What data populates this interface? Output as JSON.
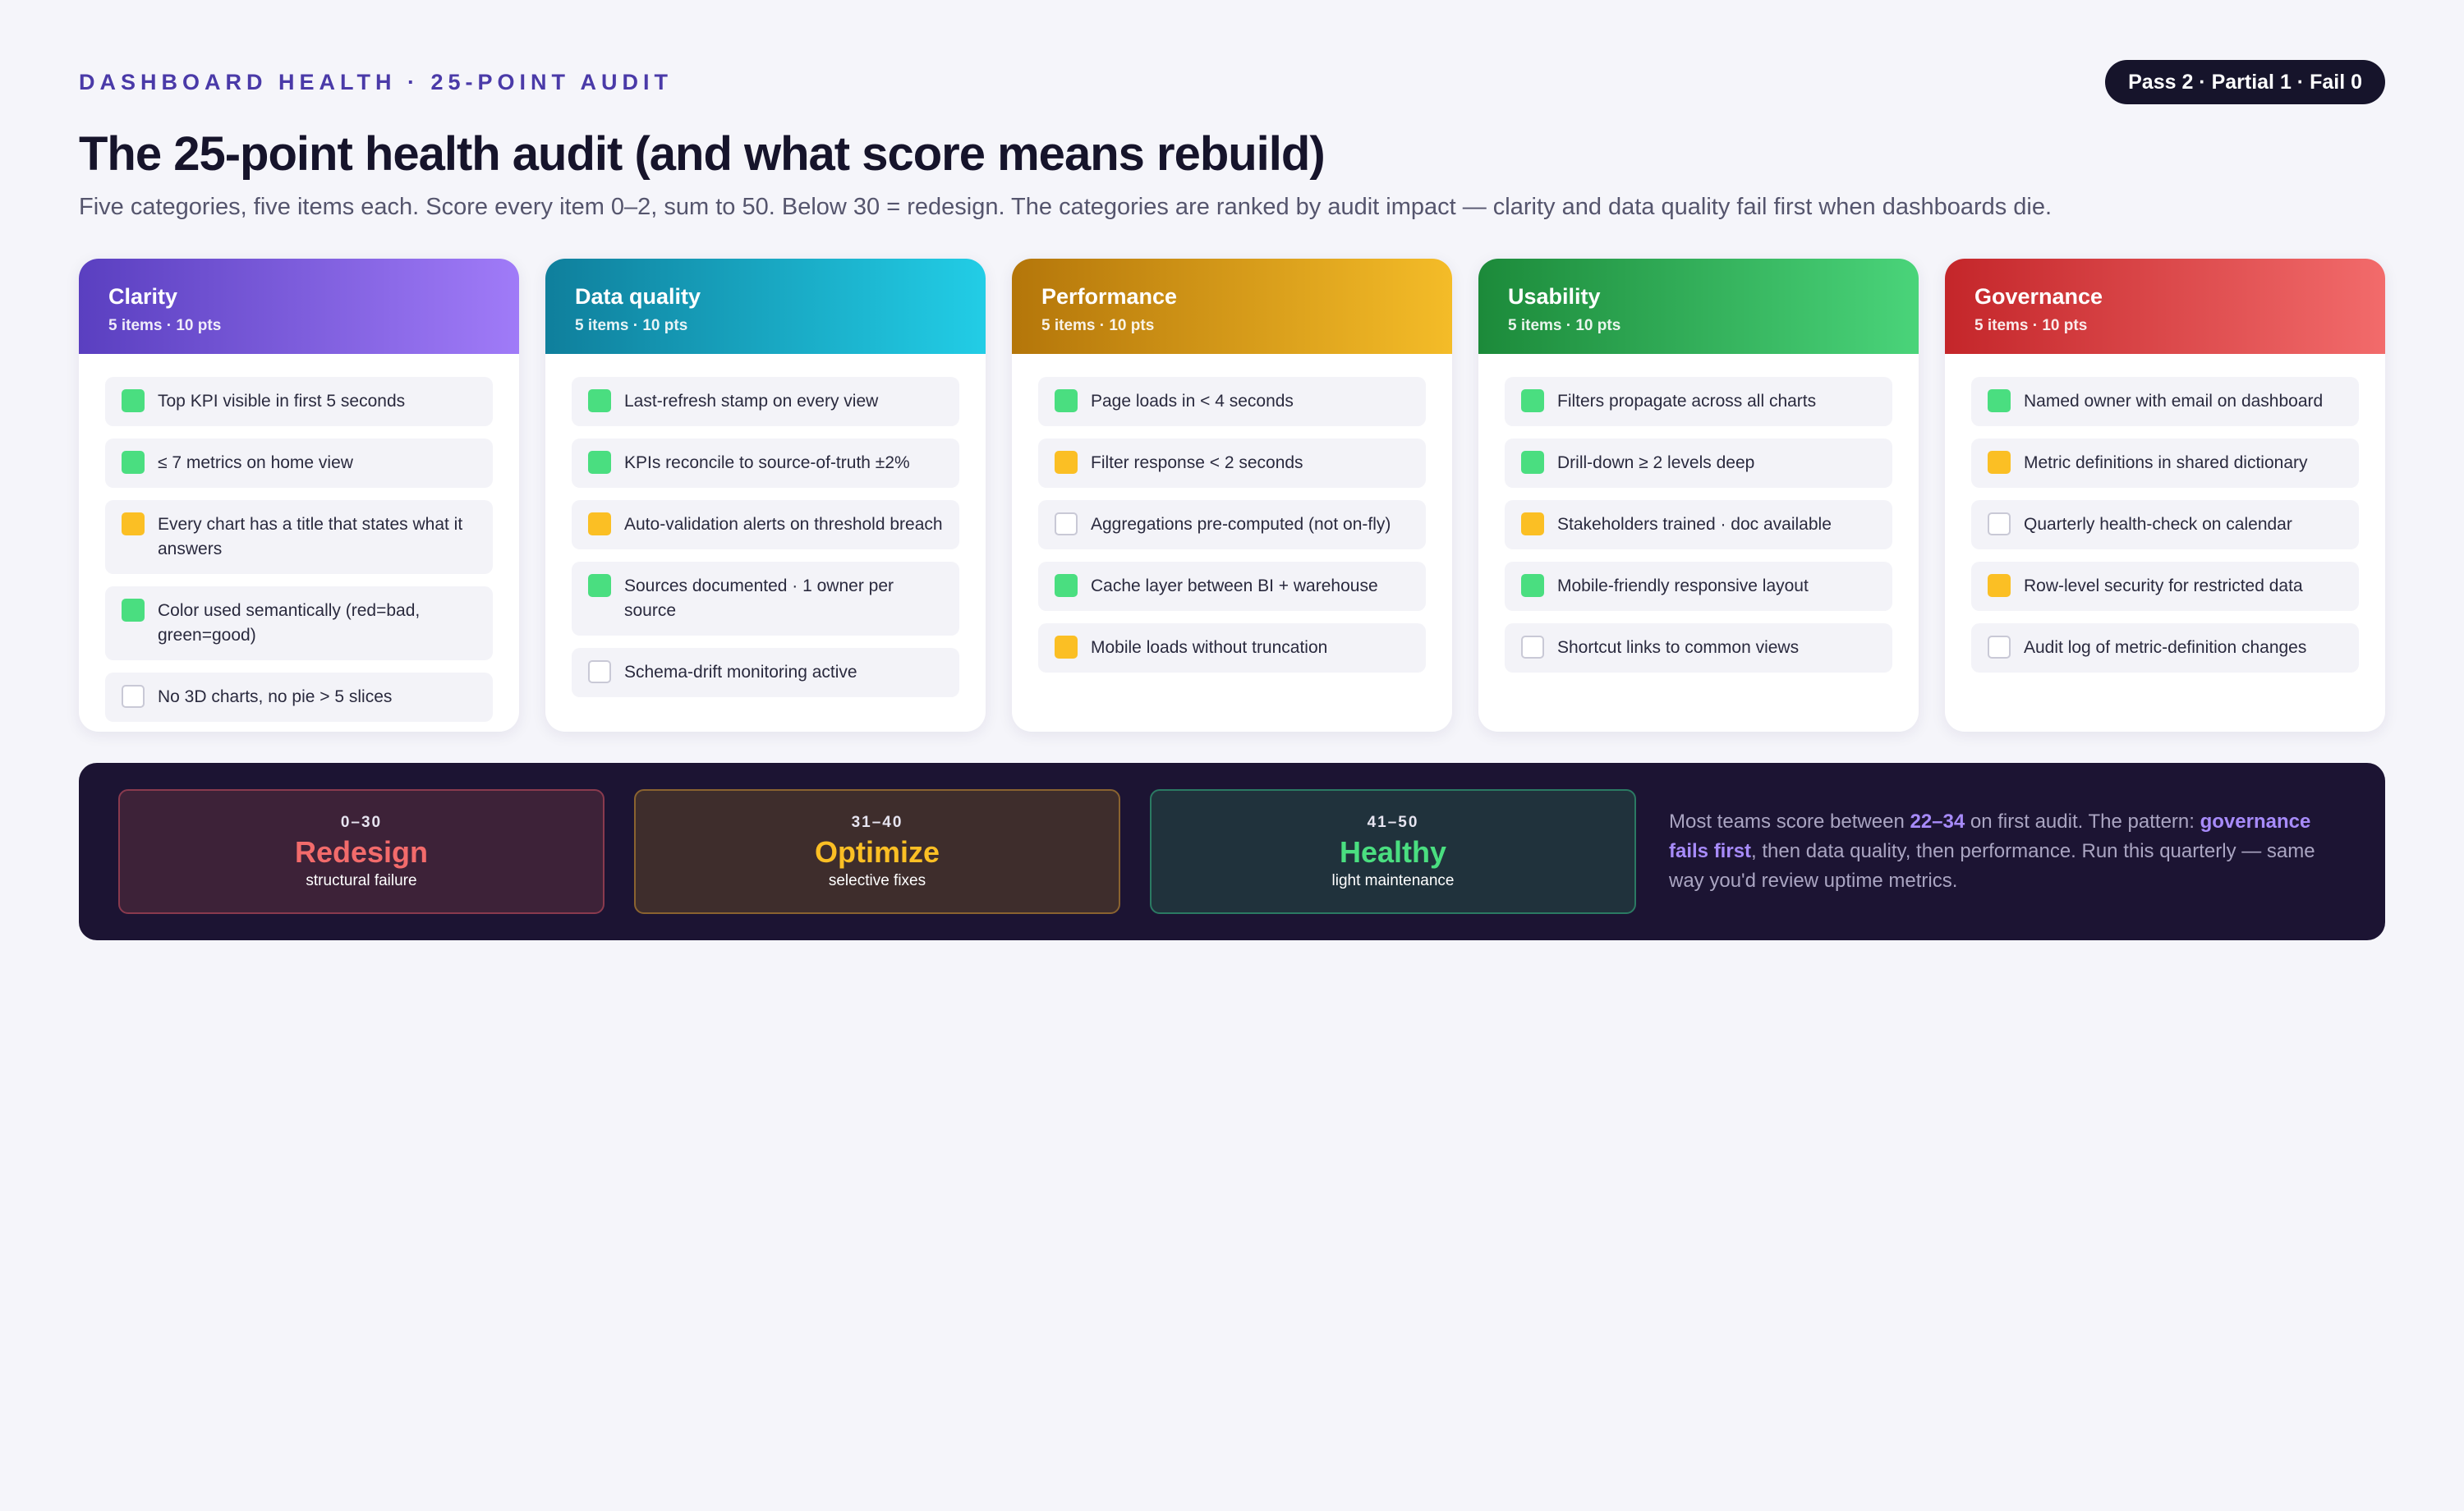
{
  "header": {
    "eyebrow": "DASHBOARD HEALTH · 25-POINT AUDIT",
    "score_summary": "Pass 2 · Partial 1 · Fail 0",
    "title": "The 25-point health audit (and what score means rebuild)",
    "subtitle": "Five categories, five items each. Score every item 0–2, sum to 50. Below 30 = redesign. The categories are ranked by audit impact — clarity and data quality fail first when dashboards die."
  },
  "status_colors": {
    "pass": "#4ade80",
    "partial": "#fbbf24",
    "fail": "#ffffff"
  },
  "categories": [
    {
      "name": "Clarity",
      "meta": "5 items · 10 pts",
      "color_from": "#5a3fc0",
      "color_to": "#a07bf8",
      "items": [
        {
          "text": "Top KPI visible in first 5 seconds",
          "status": "pass"
        },
        {
          "text": "≤ 7 metrics on home view",
          "status": "pass"
        },
        {
          "text": "Every chart has a title that states what it answers",
          "status": "partial"
        },
        {
          "text": "Color used semantically (red=bad, green=good)",
          "status": "pass"
        },
        {
          "text": "No 3D charts, no pie > 5 slices",
          "status": "fail"
        }
      ]
    },
    {
      "name": "Data quality",
      "meta": "5 items · 10 pts",
      "color_from": "#0f7f9c",
      "color_to": "#22cde6",
      "items": [
        {
          "text": "Last-refresh stamp on every view",
          "status": "pass"
        },
        {
          "text": "KPIs reconcile to source-of-truth ±2%",
          "status": "pass"
        },
        {
          "text": "Auto-validation alerts on threshold breach",
          "status": "partial"
        },
        {
          "text": "Sources documented · 1 owner per source",
          "status": "pass"
        },
        {
          "text": "Schema-drift monitoring active",
          "status": "fail"
        }
      ]
    },
    {
      "name": "Performance",
      "meta": "5 items · 10 pts",
      "color_from": "#b4760a",
      "color_to": "#f4bc28",
      "items": [
        {
          "text": "Page loads in < 4 seconds",
          "status": "pass"
        },
        {
          "text": "Filter response < 2 seconds",
          "status": "partial"
        },
        {
          "text": "Aggregations pre-computed (not on-fly)",
          "status": "fail"
        },
        {
          "text": "Cache layer between BI + warehouse",
          "status": "pass"
        },
        {
          "text": "Mobile loads without truncation",
          "status": "partial"
        }
      ]
    },
    {
      "name": "Usability",
      "meta": "5 items · 10 pts",
      "color_from": "#1c8a3a",
      "color_to": "#4ad47a",
      "items": [
        {
          "text": "Filters propagate across all charts",
          "status": "pass"
        },
        {
          "text": "Drill-down ≥ 2 levels deep",
          "status": "pass"
        },
        {
          "text": "Stakeholders trained · doc available",
          "status": "partial"
        },
        {
          "text": "Mobile-friendly responsive layout",
          "status": "pass"
        },
        {
          "text": "Shortcut links to common views",
          "status": "fail"
        }
      ]
    },
    {
      "name": "Governance",
      "meta": "5 items · 10 pts",
      "color_from": "#c4262a",
      "color_to": "#f26b6b",
      "items": [
        {
          "text": "Named owner with email on dashboard",
          "status": "pass"
        },
        {
          "text": "Metric definitions in shared dictionary",
          "status": "partial"
        },
        {
          "text": "Quarterly health-check on calendar",
          "status": "fail"
        },
        {
          "text": "Row-level security for restricted data",
          "status": "partial"
        },
        {
          "text": "Audit log of metric-definition changes",
          "status": "fail"
        }
      ]
    }
  ],
  "bands": [
    {
      "range": "0–30",
      "label": "Redesign",
      "desc": "structural failure",
      "color": "#f26b6b"
    },
    {
      "range": "31–40",
      "label": "Optimize",
      "desc": "selective fixes",
      "color": "#fbbf24"
    },
    {
      "range": "41–50",
      "label": "Healthy",
      "desc": "light maintenance",
      "color": "#4ade80"
    }
  ],
  "note": {
    "part1": "Most teams score between ",
    "highlight1": "22–34",
    "part2": " on first audit. The pattern: ",
    "highlight2": "governance fails first",
    "part3": ", then data quality, then performance. Run this quarterly — same way you'd review uptime metrics."
  }
}
